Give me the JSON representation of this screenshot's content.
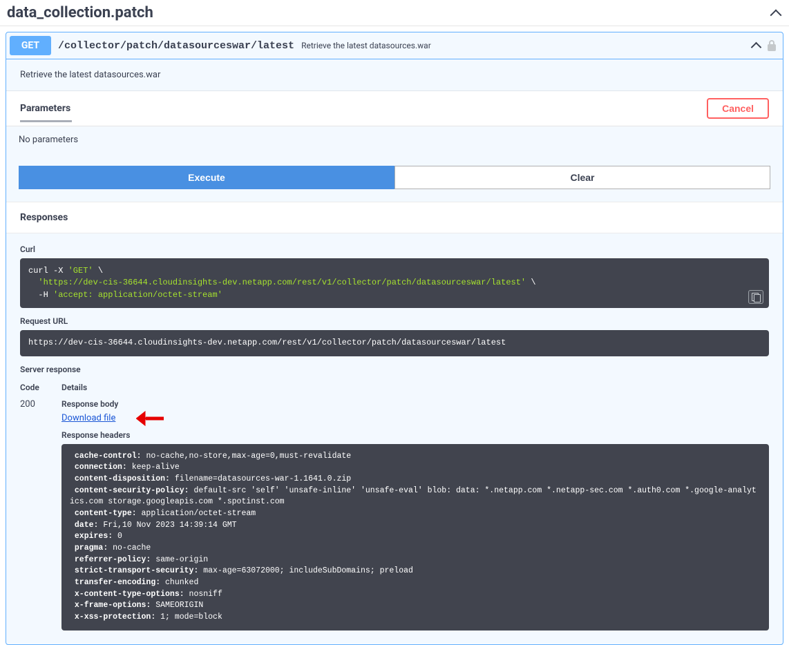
{
  "tag": {
    "title": "data_collection.patch"
  },
  "operation": {
    "method": "GET",
    "path": "/collector/patch/datasourceswar/latest",
    "summary": "Retrieve the latest datasources.war",
    "description": "Retrieve the latest datasources.war"
  },
  "parameters": {
    "section_label": "Parameters",
    "cancel_label": "Cancel",
    "no_params_text": "No parameters"
  },
  "actions": {
    "execute_label": "Execute",
    "clear_label": "Clear"
  },
  "responses": {
    "section_label": "Responses",
    "curl_label": "Curl",
    "curl_command": "curl -X 'GET' \\\n  'https://dev-cis-36644.cloudinsights-dev.netapp.com/rest/v1/collector/patch/datasourceswar/latest' \\\n  -H 'accept: application/octet-stream'",
    "request_url_label": "Request URL",
    "request_url": "https://dev-cis-36644.cloudinsights-dev.netapp.com/rest/v1/collector/patch/datasourceswar/latest",
    "server_response_label": "Server response",
    "code_col": "Code",
    "details_col": "Details",
    "status_code": "200",
    "response_body_label": "Response body",
    "download_label": "Download file",
    "response_headers_label": "Response headers",
    "headers": [
      {
        "k": "cache-control",
        "v": "no-cache,no-store,max-age=0,must-revalidate"
      },
      {
        "k": "connection",
        "v": "keep-alive"
      },
      {
        "k": "content-disposition",
        "v": "filename=datasources-war-1.1641.0.zip"
      },
      {
        "k": "content-security-policy",
        "v": "default-src 'self' 'unsafe-inline' 'unsafe-eval' blob: data: *.netapp.com *.netapp-sec.com *.auth0.com *.google-analytics.com storage.googleapis.com *.spotinst.com"
      },
      {
        "k": "content-type",
        "v": "application/octet-stream"
      },
      {
        "k": "date",
        "v": "Fri,10 Nov 2023 14:39:14 GMT"
      },
      {
        "k": "expires",
        "v": "0"
      },
      {
        "k": "pragma",
        "v": "no-cache"
      },
      {
        "k": "referrer-policy",
        "v": "same-origin"
      },
      {
        "k": "strict-transport-security",
        "v": "max-age=63072000; includeSubDomains; preload"
      },
      {
        "k": "transfer-encoding",
        "v": "chunked"
      },
      {
        "k": "x-content-type-options",
        "v": "nosniff"
      },
      {
        "k": "x-frame-options",
        "v": "SAMEORIGIN"
      },
      {
        "k": "x-xss-protection",
        "v": "1; mode=block"
      }
    ]
  }
}
